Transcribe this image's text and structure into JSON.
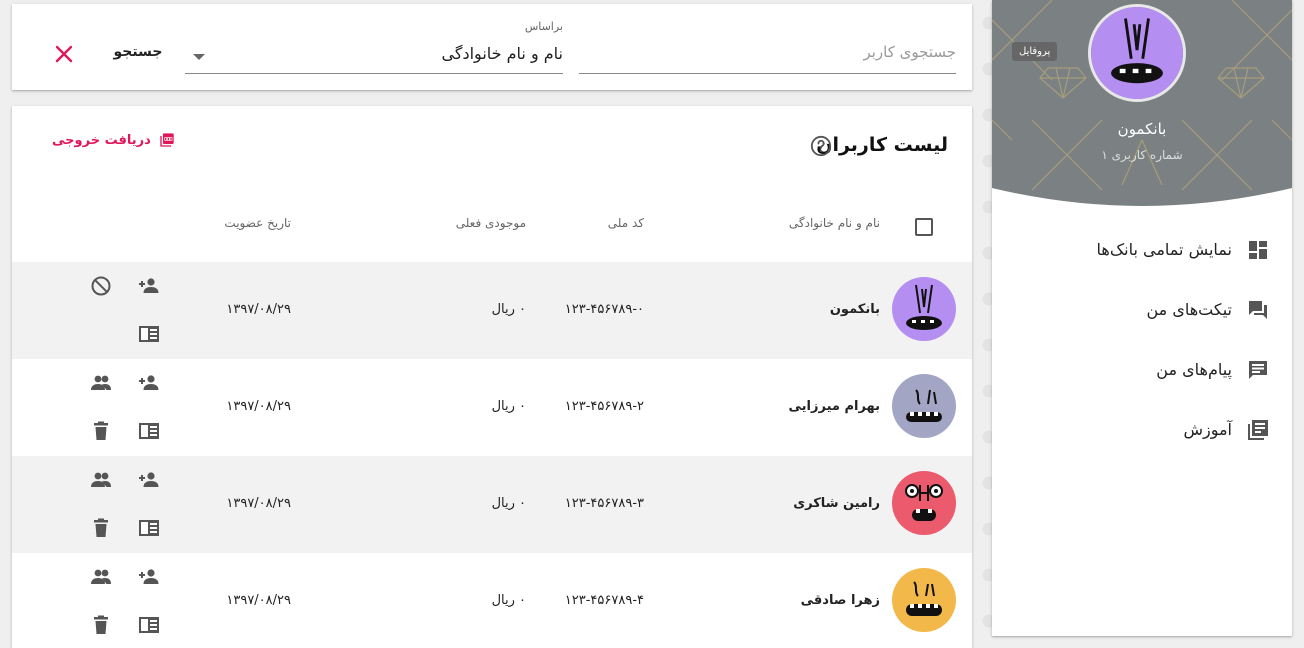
{
  "search": {
    "close_icon": "close-icon",
    "search_button": "جستجو",
    "filter_label": "براساس",
    "filter_value": "نام و نام خانوادگی",
    "query_value": "",
    "query_placeholder": "جستجوی کاربر"
  },
  "users_list": {
    "title": "لیست کاربران",
    "export_label": "دریافت خروجی",
    "columns": {
      "name": "نام و نام خانوادگی",
      "national_id": "کد ملی",
      "balance": "موجودی فعلی",
      "join_date": "تاریخ عضویت"
    },
    "rows": [
      {
        "name": "بانکمون",
        "national_id": "۱۲۳-۴۵۶۷۸۹-۰",
        "balance": "۰ ریال",
        "join_date": "۱۳۹۷/۰۸/۲۹",
        "avatar_color": "#b48ef0"
      },
      {
        "name": "بهرام میرزایی",
        "national_id": "۱۲۳-۴۵۶۷۸۹-۲",
        "balance": "۰ ریال",
        "join_date": "۱۳۹۷/۰۸/۲۹",
        "avatar_color": "#a2a6c4"
      },
      {
        "name": "رامین شاکری",
        "national_id": "۱۲۳-۴۵۶۷۸۹-۳",
        "balance": "۰ ریال",
        "join_date": "۱۳۹۷/۰۸/۲۹",
        "avatar_color": "#ec5a6e"
      },
      {
        "name": "زهرا صادقی",
        "national_id": "۱۲۳-۴۵۶۷۸۹-۴",
        "balance": "۰ ریال",
        "join_date": "۱۳۹۷/۰۸/۲۹",
        "avatar_color": "#f3b84a"
      }
    ]
  },
  "sidebar": {
    "profile_name": "بانکمون",
    "profile_subtitle": "شماره کاربری ۱",
    "profile_tooltip": "پروفایل",
    "header_color": "#7b8182",
    "menu": [
      {
        "label": "نمایش تمامی بانک‌ها",
        "icon": "dashboard-icon"
      },
      {
        "label": "تیکت‌های من",
        "icon": "forum-icon"
      },
      {
        "label": "پیام‌های من",
        "icon": "message-icon"
      },
      {
        "label": "آموزش",
        "icon": "library-books-icon"
      }
    ]
  },
  "colors": {
    "accent": "#e0185a",
    "row_shade": "#f2f2f2"
  }
}
